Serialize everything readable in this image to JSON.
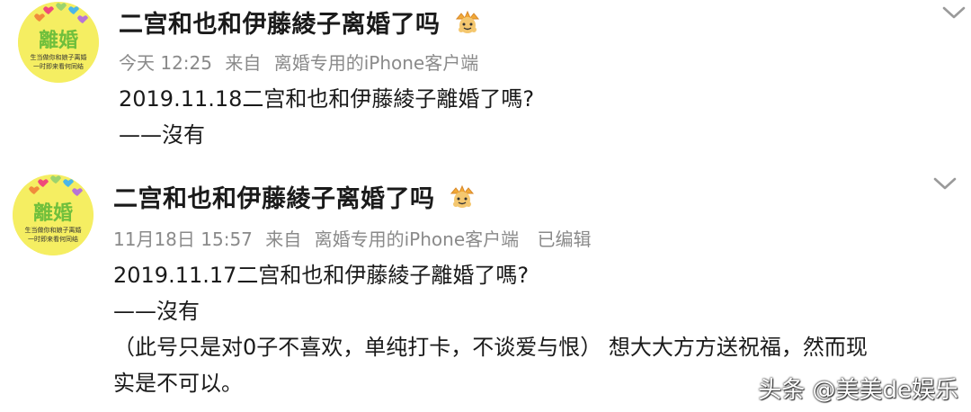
{
  "posts": [
    {
      "username": "二宫和也和伊藤綾子离婚了吗",
      "avatar_text": "離婚",
      "avatar_subtext_1": "生当做你和娘子离婚",
      "avatar_subtext_2": "一时即来看何同结",
      "time": "今天 12:25",
      "source_prefix": "来自",
      "source": "离婚专用的iPhone客户端",
      "edited": "",
      "lines": [
        "2019.11.18二宫和也和伊藤綾子離婚了嗎?",
        "——沒有"
      ]
    },
    {
      "username": "二宫和也和伊藤綾子离婚了吗",
      "avatar_text": "離婚",
      "avatar_subtext_1": "生当做你和娘子离婚",
      "avatar_subtext_2": "一时即来看何同结",
      "time": "11月18日 15:57",
      "source_prefix": "来自",
      "source": "离婚专用的iPhone客户端",
      "edited": "已编辑",
      "lines": [
        "2019.11.17二宫和也和伊藤綾子離婚了嗎?",
        "——沒有",
        "（此号只是对0子不喜欢，单纯打卡，不谈爱与恨） 想大大方方送祝福，然而现",
        "实是不可以。"
      ]
    }
  ],
  "watermark": "头条 @美美de娱乐",
  "colors": {
    "avatar_bg": "#f5ee62",
    "meta_text": "#8a8a8a",
    "main_text": "#1a1a1a"
  },
  "icons": {
    "badge": "crown-badge-icon",
    "menu": "chevron-down-icon"
  }
}
